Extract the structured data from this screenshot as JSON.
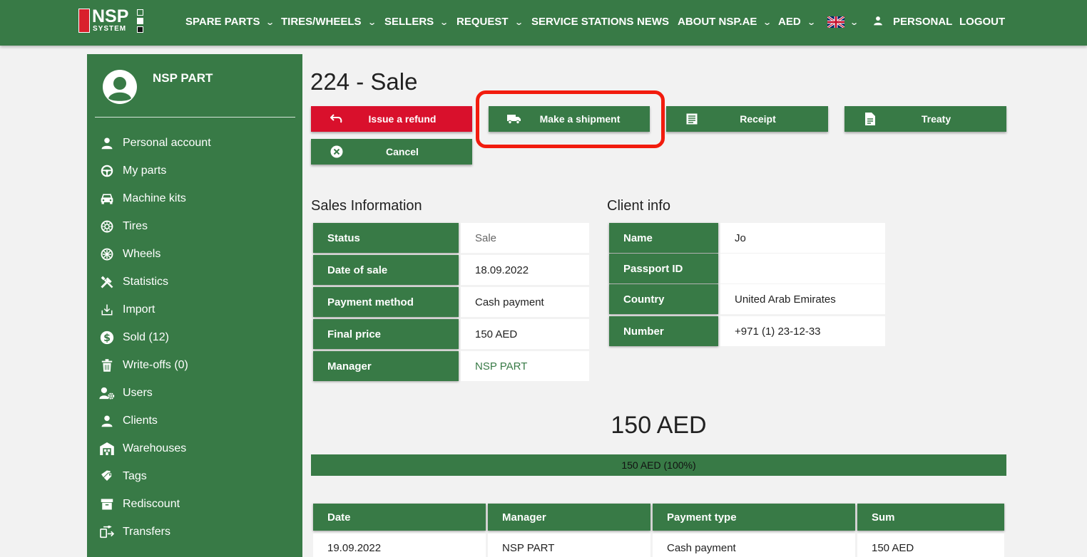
{
  "logo": {
    "brand": "NSP",
    "sub": "SYSTEM"
  },
  "nav": {
    "spare_parts": "SPARE PARTS",
    "tires_wheels": "TIRES/WHEELS",
    "sellers": "SELLERS",
    "request": "REQUEST",
    "service_stations": "SERVICE STATIONS",
    "news": "NEWS",
    "about": "ABOUT NSP.AE",
    "currency": "AED",
    "personal": "PERSONAL",
    "logout": "LOGOUT"
  },
  "sidebar": {
    "profile_name": "NSP PART",
    "items": [
      {
        "label": "Personal account",
        "icon": "person-icon"
      },
      {
        "label": "My parts",
        "icon": "steering-wheel-icon"
      },
      {
        "label": "Machine kits",
        "icon": "car-icon"
      },
      {
        "label": "Tires",
        "icon": "tire-icon"
      },
      {
        "label": "Wheels",
        "icon": "wheel-icon"
      },
      {
        "label": "Statistics",
        "icon": "tools-icon"
      },
      {
        "label": "Import",
        "icon": "import-icon"
      },
      {
        "label": "Sold (12)",
        "icon": "dollar-icon"
      },
      {
        "label": "Write-offs (0)",
        "icon": "trash-icon"
      },
      {
        "label": "Users",
        "icon": "users-gear-icon"
      },
      {
        "label": "Clients",
        "icon": "person-icon"
      },
      {
        "label": "Warehouses",
        "icon": "warehouse-icon"
      },
      {
        "label": "Tags",
        "icon": "tags-icon"
      },
      {
        "label": "Rediscount",
        "icon": "archive-icon"
      },
      {
        "label": "Transfers",
        "icon": "transfer-icon"
      }
    ]
  },
  "page": {
    "title": "224 - Sale",
    "buttons": {
      "refund": "Issue a refund",
      "shipment": "Make a shipment",
      "receipt": "Receipt",
      "treaty": "Treaty",
      "cancel": "Cancel"
    }
  },
  "sales_info": {
    "title": "Sales Information",
    "rows": [
      {
        "label": "Status",
        "value": "Sale"
      },
      {
        "label": "Date of sale",
        "value": "18.09.2022"
      },
      {
        "label": "Payment method",
        "value": "Cash payment"
      },
      {
        "label": "Final price",
        "value": "150 AED"
      },
      {
        "label": "Manager",
        "value": "NSP PART"
      }
    ]
  },
  "client_info": {
    "title": "Client info",
    "rows": [
      {
        "label": "Name",
        "value": "Jo"
      },
      {
        "label": "Passport ID",
        "value": ""
      },
      {
        "label": "Country",
        "value": "United Arab Emirates"
      },
      {
        "label": "Number",
        "value": "+971 (1) 23-12-33"
      }
    ]
  },
  "payment": {
    "total": "150 AED",
    "progress_text": "150 AED (100%)",
    "progress_fraction": 1.0
  },
  "payments_table": {
    "headers": [
      "Date",
      "Manager",
      "Payment type",
      "Sum"
    ],
    "rows": [
      [
        "19.09.2022",
        "NSP PART",
        "Cash payment",
        "150 AED"
      ]
    ]
  },
  "colors": {
    "green": "#387a46",
    "red": "#d9102c",
    "highlight": "#f21c0e"
  }
}
